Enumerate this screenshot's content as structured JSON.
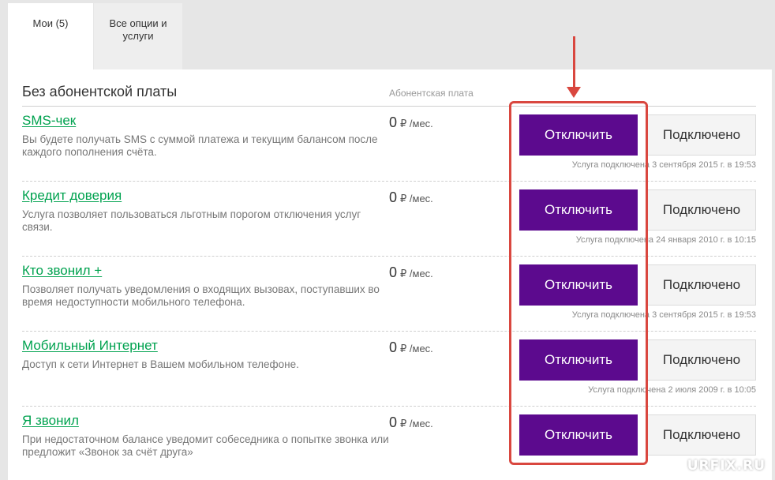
{
  "tabs": [
    {
      "label": "Мои (5)",
      "active": true
    },
    {
      "label": "Все опции и услуги",
      "active": false
    }
  ],
  "section": {
    "title": "Без абонентской платы",
    "fee_header": "Абонентская плата"
  },
  "services": [
    {
      "name": "SMS-чек",
      "description": "Вы будете получать SMS с суммой платежа и текущим балансом после каждого пополнения счёта.",
      "fee": "0",
      "fee_unit": "₽ /мес.",
      "disable_label": "Отключить",
      "status_label": "Подключено",
      "connected_since": "Услуга подключена 3 сентября 2015 г. в 19:53"
    },
    {
      "name": "Кредит доверия",
      "description": "Услуга позволяет пользоваться льготным порогом отключения услуг связи.",
      "fee": "0",
      "fee_unit": "₽ /мес.",
      "disable_label": "Отключить",
      "status_label": "Подключено",
      "connected_since": "Услуга подключена 24 января 2010 г. в 10:15"
    },
    {
      "name": "Кто звонил +",
      "description": "Позволяет получать уведомления о входящих вызовах, поступавших во время недоступности мобильного телефона.",
      "fee": "0",
      "fee_unit": "₽ /мес.",
      "disable_label": "Отключить",
      "status_label": "Подключено",
      "connected_since": "Услуга подключена 3 сентября 2015 г. в 19:53"
    },
    {
      "name": "Мобильный Интернет",
      "description": "Доступ к сети Интернет в Вашем мобильном телефоне.",
      "fee": "0",
      "fee_unit": "₽ /мес.",
      "disable_label": "Отключить",
      "status_label": "Подключено",
      "connected_since": "Услуга подключена 2 июля 2009 г. в 10:05"
    },
    {
      "name": "Я звонил",
      "description": "При недостаточном балансе уведомит собеседника о попытке звонка или предложит «Звонок за счёт друга»",
      "fee": "0",
      "fee_unit": "₽ /мес.",
      "disable_label": "Отключить",
      "status_label": "Подключено",
      "connected_since": ""
    }
  ],
  "watermark": "URFIX.RU",
  "colors": {
    "accent_purple": "#5c0a8e",
    "link_green": "#00a24f",
    "annotation_red": "#d9473f"
  }
}
